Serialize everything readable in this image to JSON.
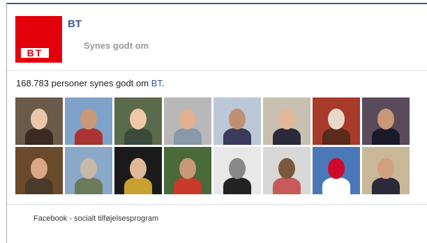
{
  "page": {
    "name": "BT",
    "logo_text": "BT",
    "like_label": "Synes godt om"
  },
  "likes": {
    "prefix": "168.783 personer synes godt om",
    "page_link": "BT",
    "suffix": "."
  },
  "faces": [
    {
      "bg": "#6b5a4a",
      "head": "#e8c8a8",
      "body": "#3a2a22"
    },
    {
      "bg": "#7fa3c8",
      "head": "#c89878",
      "body": "#a33"
    },
    {
      "bg": "#5a6a4a",
      "head": "#f0c8a8",
      "body": "#3a4a3a"
    },
    {
      "bg": "#b8b8b8",
      "head": "#e0b090",
      "body": "#8899aa"
    },
    {
      "bg": "#bcc8d8",
      "head": "#c09070",
      "body": "#3a3a5a"
    },
    {
      "bg": "#c8c0b0",
      "head": "#e0b898",
      "body": "#2a2a3a"
    },
    {
      "bg": "#a83a2a",
      "head": "#e8d8c8",
      "body": "#5a2a1a"
    },
    {
      "bg": "#5a4a5a",
      "head": "#c89878",
      "body": "#1a1a2a"
    },
    {
      "bg": "#6a4a2a",
      "head": "#d8a888",
      "body": "#4a3a2a"
    },
    {
      "bg": "#8aa8c8",
      "head": "#c8b8a8",
      "body": "#6a7a5a"
    },
    {
      "bg": "#1a1a1a",
      "head": "#e0b898",
      "body": "#c8a030"
    },
    {
      "bg": "#4a6a3a",
      "head": "#c89878",
      "body": "#c83a2a"
    },
    {
      "bg": "#e8e8e8",
      "head": "#888888",
      "body": "#222222"
    },
    {
      "bg": "#d8d8d8",
      "head": "#7a5a3a",
      "body": "#c85a5a"
    },
    {
      "bg": "#4a78b8",
      "head": "#d00a2a",
      "body": "#ffffff"
    },
    {
      "bg": "#c8b898",
      "head": "#d0a080",
      "body": "#2a2a3a"
    }
  ],
  "footer": {
    "text": "Facebook - socialt tilføjelsesprogram"
  }
}
